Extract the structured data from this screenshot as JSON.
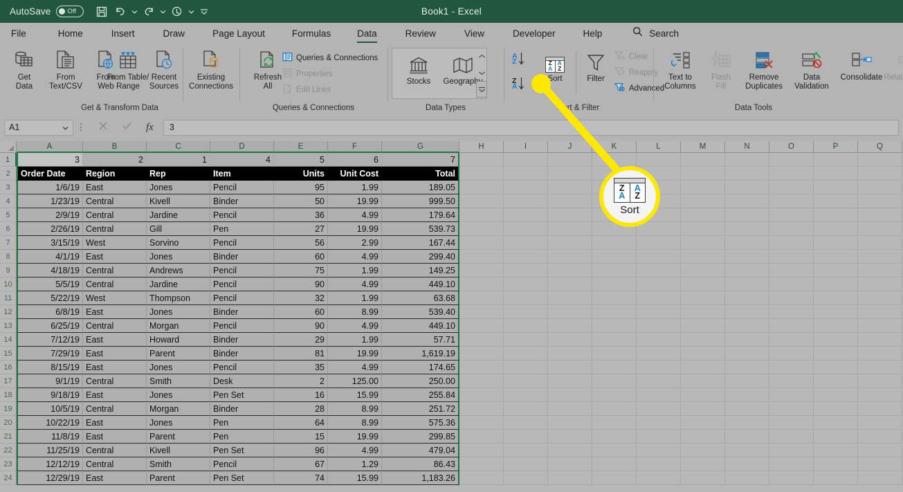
{
  "titlebar": {
    "autosave_label": "AutoSave",
    "autosave_state": "Off",
    "document_title": "Book1  -  Excel",
    "qat": [
      {
        "name": "save-icon",
        "label": "Save"
      },
      {
        "name": "undo-icon",
        "label": "Undo"
      },
      {
        "name": "redo-icon",
        "label": "Redo"
      },
      {
        "name": "touch-mode-icon",
        "label": "Touch/Mouse Mode"
      },
      {
        "name": "customize-qat-icon",
        "label": "Customize Quick Access Toolbar"
      }
    ]
  },
  "tabs": [
    {
      "label": "File",
      "active": false
    },
    {
      "label": "Home",
      "active": false
    },
    {
      "label": "Insert",
      "active": false
    },
    {
      "label": "Draw",
      "active": false
    },
    {
      "label": "Page Layout",
      "active": false
    },
    {
      "label": "Formulas",
      "active": false
    },
    {
      "label": "Data",
      "active": true
    },
    {
      "label": "Review",
      "active": false
    },
    {
      "label": "View",
      "active": false
    },
    {
      "label": "Developer",
      "active": false
    },
    {
      "label": "Help",
      "active": false
    }
  ],
  "search": {
    "label": "Search"
  },
  "ribbon": {
    "groups": [
      {
        "name": "get-and-transform-data",
        "label": "Get & Transform Data",
        "buttons": [
          {
            "label": "Get\nData",
            "has_caret": true,
            "disabled": false
          },
          {
            "label": "From\nText/CSV",
            "has_caret": false,
            "disabled": false
          },
          {
            "label": "From\nWeb",
            "has_caret": false,
            "disabled": false
          },
          {
            "label": "From Table/\nRange",
            "has_caret": false,
            "disabled": false
          },
          {
            "label": "Recent\nSources",
            "has_caret": false,
            "disabled": false
          },
          {
            "label": "Existing\nConnections",
            "has_caret": false,
            "disabled": false
          }
        ]
      },
      {
        "name": "queries-and-connections",
        "label": "Queries & Connections",
        "big": {
          "label": "Refresh\nAll",
          "has_caret": true
        },
        "small": [
          {
            "label": "Queries & Connections",
            "disabled": false
          },
          {
            "label": "Properties",
            "disabled": true
          },
          {
            "label": "Edit Links",
            "disabled": true
          }
        ]
      },
      {
        "name": "data-types",
        "label": "Data Types",
        "buttons": [
          {
            "label": "Stocks",
            "disabled": false
          },
          {
            "label": "Geography",
            "disabled": false
          }
        ]
      },
      {
        "name": "sort-and-filter",
        "label": "Sort & Filter",
        "sort_asc_label": "Sort A to Z",
        "sort_desc_label": "Sort Z to A",
        "sort_label": "Sort",
        "filter_label": "Filter",
        "small": [
          {
            "label": "Clear",
            "disabled": true
          },
          {
            "label": "Reapply",
            "disabled": true
          },
          {
            "label": "Advanced",
            "disabled": false
          }
        ]
      },
      {
        "name": "data-tools",
        "label": "Data Tools",
        "buttons": [
          {
            "label": "Text to\nColumns",
            "has_caret": false,
            "disabled": false
          },
          {
            "label": "Flash\nFill",
            "has_caret": false,
            "disabled": true
          },
          {
            "label": "Remove\nDuplicates",
            "has_caret": false,
            "disabled": false
          },
          {
            "label": "Data\nValidation",
            "has_caret": true,
            "disabled": false
          },
          {
            "label": "Consolidate",
            "has_caret": false,
            "disabled": false
          },
          {
            "label": "Relationships",
            "has_caret": false,
            "disabled": true
          }
        ]
      }
    ]
  },
  "formula_bar": {
    "name_box_value": "A1",
    "cancel_label": "Cancel",
    "enter_label": "Enter",
    "fx_label": "Insert Function",
    "formula_value": "3"
  },
  "callout": {
    "label": "Sort",
    "icon_top_left": "Z",
    "icon_bottom_left": "A",
    "icon_top_right": "A",
    "icon_bottom_right": "Z",
    "highlight_color": "#ffe800"
  },
  "sheet": {
    "columns": [
      "A",
      "B",
      "C",
      "D",
      "E",
      "F",
      "G",
      "H",
      "I",
      "J",
      "K",
      "L",
      "M",
      "N",
      "O",
      "P",
      "Q"
    ],
    "selected_columns": [
      "A",
      "B",
      "C",
      "D",
      "E",
      "F",
      "G"
    ],
    "row_numbers": [
      1,
      2,
      3,
      4,
      5,
      6,
      7,
      8,
      9,
      10,
      11,
      12,
      13,
      14,
      15,
      16,
      17,
      18,
      19,
      20,
      21,
      22,
      23,
      24
    ],
    "helper_row": [
      "3",
      "2",
      "1",
      "4",
      "5",
      "6",
      "7"
    ],
    "headers": [
      "Order Date",
      "Region",
      "Rep",
      "Item",
      "Units",
      "Unit Cost",
      "Total"
    ],
    "rows": [
      [
        "1/6/19",
        "East",
        "Jones",
        "Pencil",
        "95",
        "1.99",
        "189.05"
      ],
      [
        "1/23/19",
        "Central",
        "Kivell",
        "Binder",
        "50",
        "19.99",
        "999.50"
      ],
      [
        "2/9/19",
        "Central",
        "Jardine",
        "Pencil",
        "36",
        "4.99",
        "179.64"
      ],
      [
        "2/26/19",
        "Central",
        "Gill",
        "Pen",
        "27",
        "19.99",
        "539.73"
      ],
      [
        "3/15/19",
        "West",
        "Sorvino",
        "Pencil",
        "56",
        "2.99",
        "167.44"
      ],
      [
        "4/1/19",
        "East",
        "Jones",
        "Binder",
        "60",
        "4.99",
        "299.40"
      ],
      [
        "4/18/19",
        "Central",
        "Andrews",
        "Pencil",
        "75",
        "1.99",
        "149.25"
      ],
      [
        "5/5/19",
        "Central",
        "Jardine",
        "Pencil",
        "90",
        "4.99",
        "449.10"
      ],
      [
        "5/22/19",
        "West",
        "Thompson",
        "Pencil",
        "32",
        "1.99",
        "63.68"
      ],
      [
        "6/8/19",
        "East",
        "Jones",
        "Binder",
        "60",
        "8.99",
        "539.40"
      ],
      [
        "6/25/19",
        "Central",
        "Morgan",
        "Pencil",
        "90",
        "4.99",
        "449.10"
      ],
      [
        "7/12/19",
        "East",
        "Howard",
        "Binder",
        "29",
        "1.99",
        "57.71"
      ],
      [
        "7/29/19",
        "East",
        "Parent",
        "Binder",
        "81",
        "19.99",
        "1,619.19"
      ],
      [
        "8/15/19",
        "East",
        "Jones",
        "Pencil",
        "35",
        "4.99",
        "174.65"
      ],
      [
        "9/1/19",
        "Central",
        "Smith",
        "Desk",
        "2",
        "125.00",
        "250.00"
      ],
      [
        "9/18/19",
        "East",
        "Jones",
        "Pen Set",
        "16",
        "15.99",
        "255.84"
      ],
      [
        "10/5/19",
        "Central",
        "Morgan",
        "Binder",
        "28",
        "8.99",
        "251.72"
      ],
      [
        "10/22/19",
        "East",
        "Jones",
        "Pen",
        "64",
        "8.99",
        "575.36"
      ],
      [
        "11/8/19",
        "East",
        "Parent",
        "Pen",
        "15",
        "19.99",
        "299.85"
      ],
      [
        "11/25/19",
        "Central",
        "Kivell",
        "Pen Set",
        "96",
        "4.99",
        "479.04"
      ],
      [
        "12/12/19",
        "Central",
        "Smith",
        "Pencil",
        "67",
        "1.29",
        "86.43"
      ],
      [
        "12/29/19",
        "East",
        "Parent",
        "Pen Set",
        "74",
        "15.99",
        "1,183.26"
      ]
    ]
  }
}
